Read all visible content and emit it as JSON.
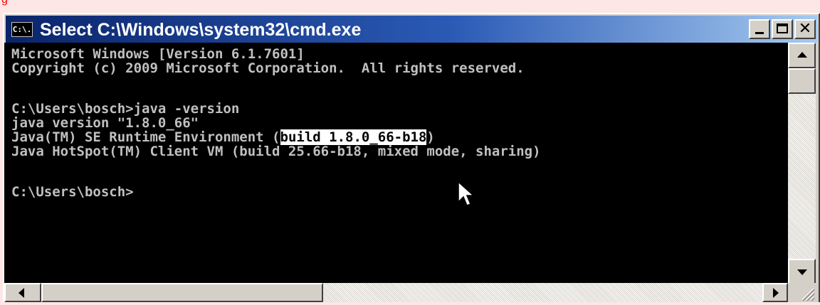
{
  "window": {
    "title": "Select C:\\Windows\\system32\\cmd.exe",
    "icon_text": "C:\\.",
    "icon": "cmd-icon"
  },
  "caption_buttons": {
    "minimize_icon": "minimize-icon",
    "maximize_icon": "maximize-icon",
    "close_label": "✕"
  },
  "console": {
    "lines": [
      "Microsoft Windows [Version 6.1.7601]",
      "Copyright (c) 2009 Microsoft Corporation.  All rights reserved.",
      "",
      "C:\\Users\\bosch>java -version",
      "java version \"1.8.0_66\"",
      "Java(TM) SE Runtime Environment (",
      "Java HotSpot(TM) Client VM (build 25.66-b18, mixed mode, sharing)",
      "",
      "C:\\Users\\bosch>"
    ],
    "selected_text": "build 1.8.0_66-b18",
    "after_selection": ")",
    "colors": {
      "background": "#000000",
      "text": "#c0c0c0",
      "selection_bg": "#ffffff",
      "selection_text": "#000000"
    }
  },
  "cursor": {
    "icon": "mouse-pointer-icon"
  }
}
